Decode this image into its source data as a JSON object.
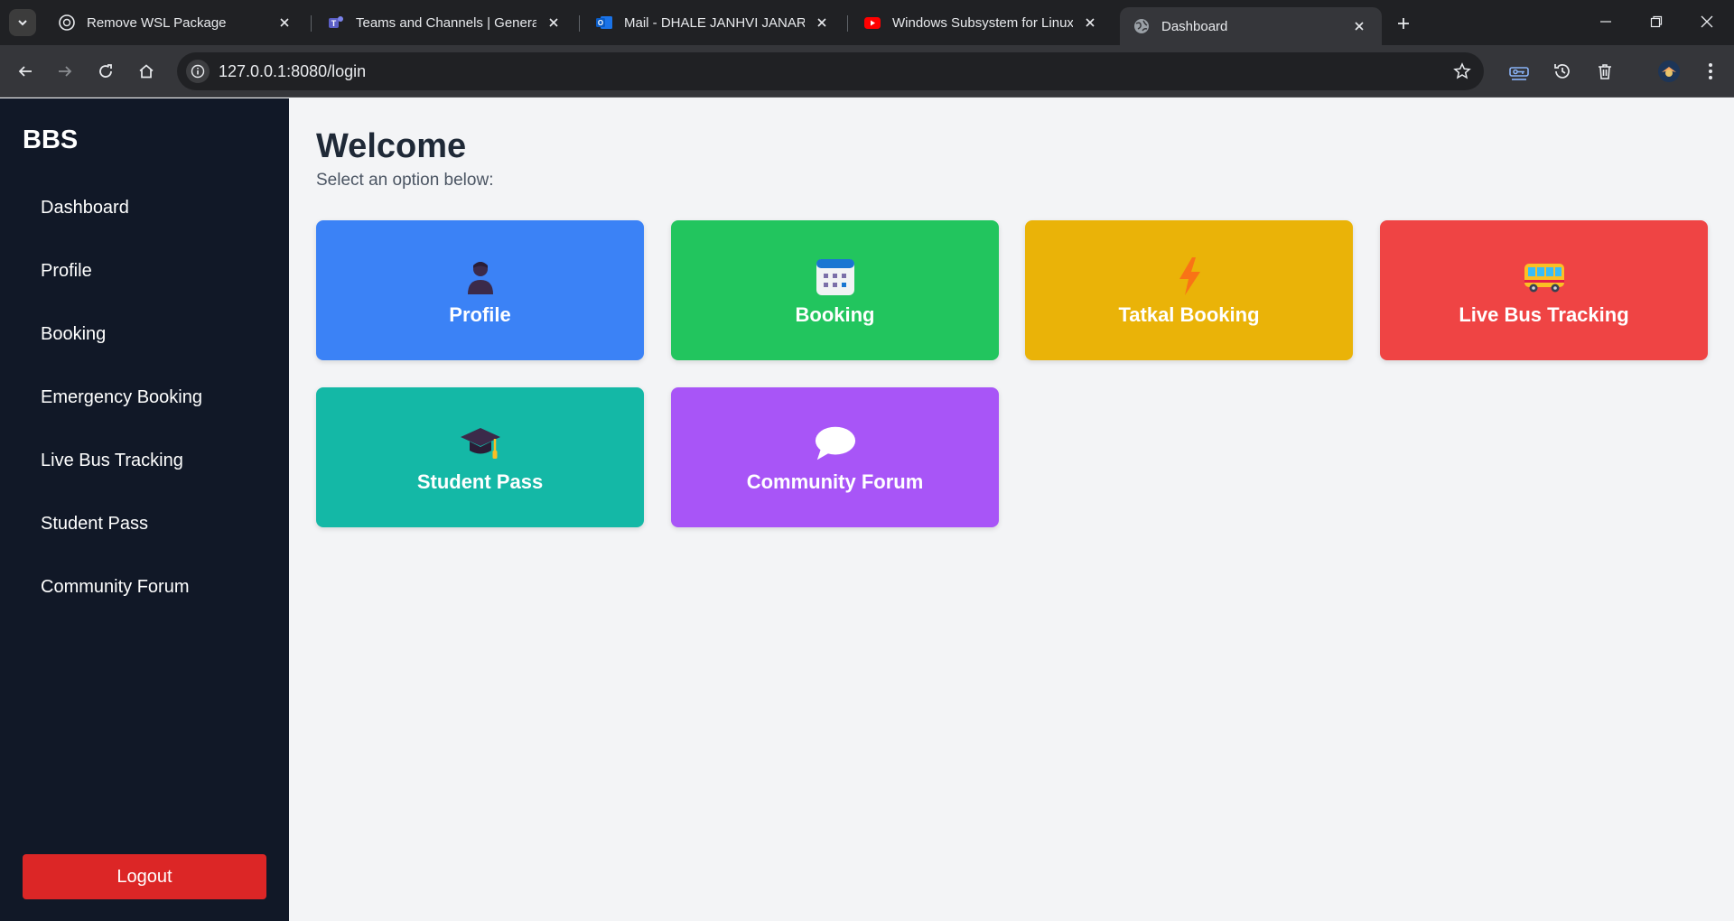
{
  "browser": {
    "tabs": [
      {
        "title": "Remove WSL Package",
        "icon": "chatgpt-icon"
      },
      {
        "title": "Teams and Channels | General |",
        "icon": "teams-icon"
      },
      {
        "title": "Mail - DHALE JANHVI JANARDH",
        "icon": "outlook-icon"
      },
      {
        "title": "Windows Subsystem for Linux r",
        "icon": "youtube-icon"
      },
      {
        "title": "Dashboard",
        "icon": "globe-icon",
        "active": true
      }
    ],
    "url": "127.0.0.1:8080/login"
  },
  "sidebar": {
    "brand": "BBS",
    "items": [
      {
        "label": "Dashboard"
      },
      {
        "label": "Profile"
      },
      {
        "label": "Booking"
      },
      {
        "label": "Emergency Booking"
      },
      {
        "label": "Live Bus Tracking"
      },
      {
        "label": "Student Pass"
      },
      {
        "label": "Community Forum"
      }
    ],
    "logout_label": "Logout"
  },
  "main": {
    "title": "Welcome",
    "subtitle": "Select an option below:",
    "cards": [
      {
        "label": "Profile",
        "icon": "person-icon",
        "color": "#3b82f6"
      },
      {
        "label": "Booking",
        "icon": "calendar-icon",
        "color": "#22c55e"
      },
      {
        "label": "Tatkal Booking",
        "icon": "lightning-icon",
        "color": "#eab308"
      },
      {
        "label": "Live Bus Tracking",
        "icon": "bus-icon",
        "color": "#ef4444"
      },
      {
        "label": "Student Pass",
        "icon": "graduation-cap-icon",
        "color": "#14b8a6"
      },
      {
        "label": "Community Forum",
        "icon": "speech-bubble-icon",
        "color": "#a855f7"
      }
    ]
  },
  "colors": {
    "sidebar_bg": "#111827",
    "main_bg": "#f3f4f6",
    "logout": "#dc2626"
  }
}
